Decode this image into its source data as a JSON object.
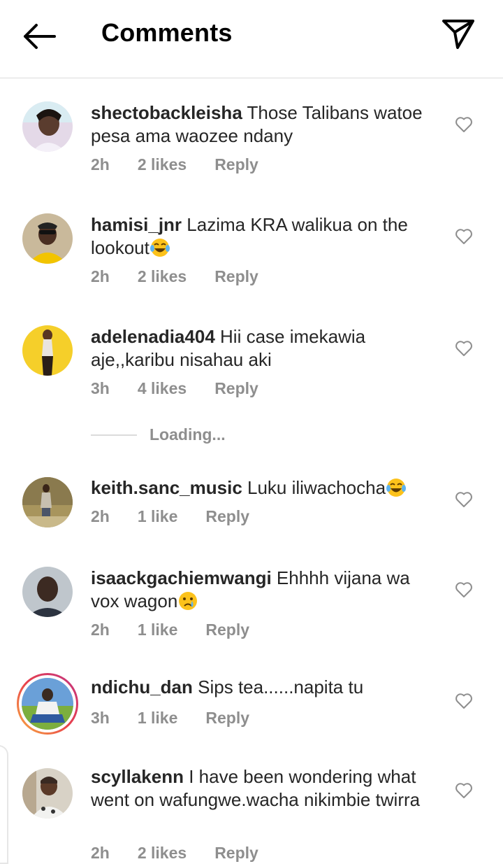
{
  "header": {
    "title": "Comments",
    "back_icon": "arrow-left-icon",
    "send_icon": "paper-plane-icon"
  },
  "comments": [
    {
      "username": "shectobackleisha",
      "text": "Those Talibans watoe pesa ama waozee ndany",
      "time": "2h",
      "likes": "2 likes",
      "reply": "Reply",
      "emoji": ""
    },
    {
      "username": "hamisi_jnr",
      "text": "Lazima KRA walikua on the lookout",
      "time": "2h",
      "likes": "2 likes",
      "reply": "Reply",
      "emoji": "laughing-tears-emoji"
    },
    {
      "username": "adelenadia404",
      "text": "Hii case imekawia aje,,karibu nisahau aki",
      "time": "3h",
      "likes": "4 likes",
      "reply": "Reply",
      "emoji": ""
    },
    {
      "username": "keith.sanc_music",
      "text": "Luku iliwachocha",
      "time": "2h",
      "likes": "1 like",
      "reply": "Reply",
      "emoji": "laughing-tears-emoji"
    },
    {
      "username": "isaackgachiemwangi",
      "text": "Ehhhh vijana wa vox wagon",
      "time": "2h",
      "likes": "1 like",
      "reply": "Reply",
      "emoji": "crying-emoji"
    },
    {
      "username": "ndichu_dan",
      "text": "Sips tea......napita tu",
      "time": "3h",
      "likes": "1 like",
      "reply": "Reply",
      "emoji": ""
    },
    {
      "username": "scyllakenn",
      "text": "I have been wondering what went on wafungwe.wacha nikimbie twirra",
      "time": "2h",
      "likes": "2 likes",
      "reply": "Reply",
      "emoji": ""
    }
  ],
  "loading": {
    "label": "Loading..."
  },
  "colors": {
    "text": "#262626",
    "meta": "#8e8e8e",
    "divider": "#dbdbdb",
    "story_ring": "#e8404c"
  }
}
